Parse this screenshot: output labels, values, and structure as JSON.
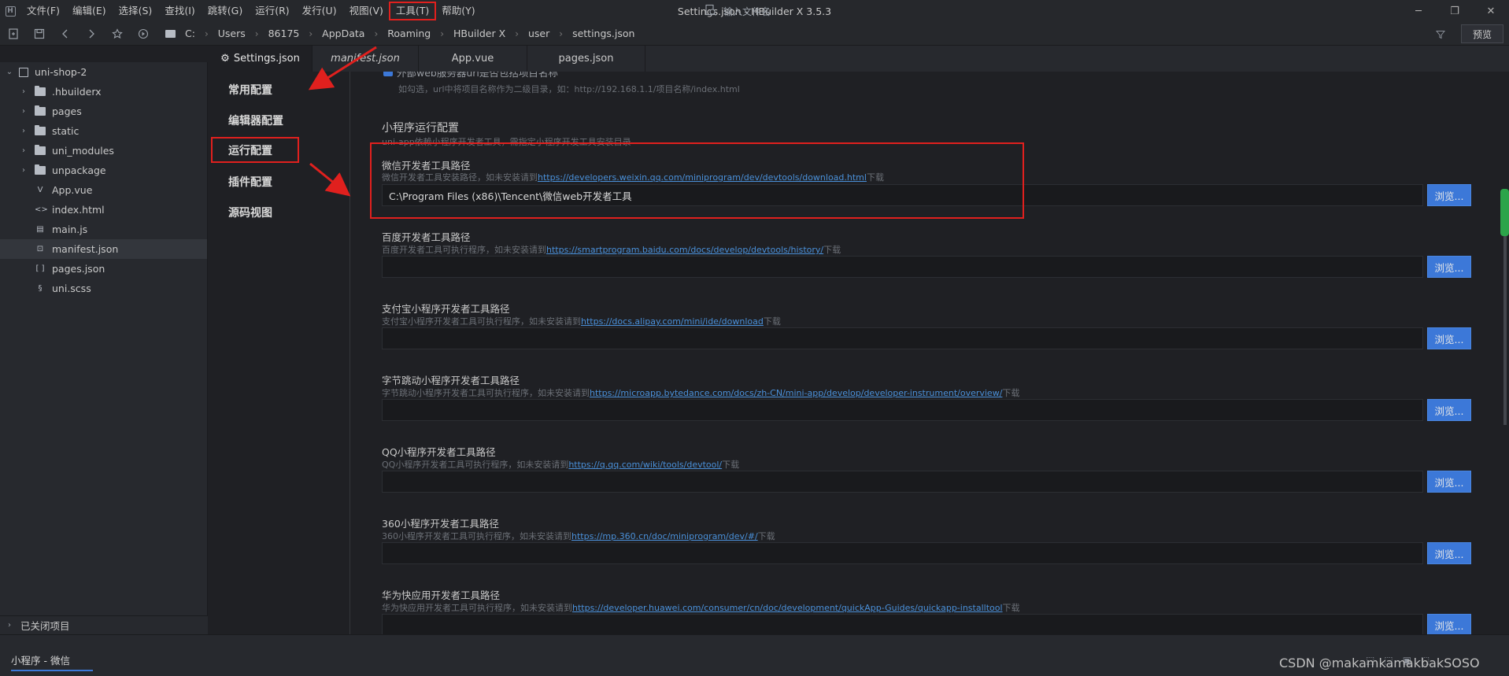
{
  "window": {
    "title": "Settings.json - HBuilder X 3.5.3",
    "logo_letter": "H",
    "controls": [
      "─",
      "❐",
      "✕"
    ]
  },
  "menu": [
    "文件(F)",
    "编辑(E)",
    "选择(S)",
    "查找(I)",
    "跳转(G)",
    "运行(R)",
    "发行(U)",
    "视图(V)",
    "工具(T)",
    "帮助(Y)"
  ],
  "breadcrumb": [
    "C:",
    "Users",
    "86175",
    "AppData",
    "Roaming",
    "HBuilder X",
    "user",
    "settings.json"
  ],
  "file_search": {
    "placeholder": "输入文件名"
  },
  "preview_label": "预览",
  "sidebar": {
    "project": "uni-shop-2",
    "items": [
      {
        "label": ".hbuilderx",
        "type": "folder"
      },
      {
        "label": "pages",
        "type": "folder"
      },
      {
        "label": "static",
        "type": "folder"
      },
      {
        "label": "uni_modules",
        "type": "folder"
      },
      {
        "label": "unpackage",
        "type": "folder"
      },
      {
        "label": "App.vue",
        "type": "vue"
      },
      {
        "label": "index.html",
        "type": "html"
      },
      {
        "label": "main.js",
        "type": "js"
      },
      {
        "label": "manifest.json",
        "type": "json-config"
      },
      {
        "label": "pages.json",
        "type": "json"
      },
      {
        "label": "uni.scss",
        "type": "scss"
      }
    ],
    "closed_projects": "已关闭项目"
  },
  "tabs": [
    {
      "label": "Settings.json"
    },
    {
      "label": "manifest.json"
    },
    {
      "label": "App.vue"
    },
    {
      "label": "pages.json"
    }
  ],
  "settings_nav": [
    {
      "label": "常用配置"
    },
    {
      "label": "编辑器配置"
    },
    {
      "label": "运行配置"
    },
    {
      "label": "插件配置"
    },
    {
      "label": "源码视图"
    }
  ],
  "main": {
    "top_cut_label": "外部web服务器url是否包括项目名称",
    "top_cut_desc": "如勾选，url中将项目名称作为二级目录，如：http://192.168.1.1/项目名称/index.html",
    "section_title": "小程序运行配置",
    "section_desc": "uni-app依赖小程序开发者工具，需指定小程序开发工具安装目录",
    "browse_label": "浏览...",
    "fields": [
      {
        "label": "微信开发者工具路径",
        "desc_prefix": "微信开发者工具安装路径，如未安装请到",
        "link": "https://developers.weixin.qq.com/miniprogram/dev/devtools/download.html",
        "desc_suffix": "下载",
        "value": "C:\\Program Files (x86)\\Tencent\\微信web开发者工具"
      },
      {
        "label": "百度开发者工具路径",
        "desc_prefix": "百度开发者工具可执行程序，如未安装请到",
        "link": "https://smartprogram.baidu.com/docs/develop/devtools/history/",
        "desc_suffix": "下载",
        "value": ""
      },
      {
        "label": "支付宝小程序开发者工具路径",
        "desc_prefix": "支付宝小程序开发者工具可执行程序，如未安装请到",
        "link": "https://docs.alipay.com/mini/ide/download",
        "desc_suffix": "下载",
        "value": ""
      },
      {
        "label": "字节跳动小程序开发者工具路径",
        "desc_prefix": "字节跳动小程序开发者工具可执行程序，如未安装请到",
        "link": "https://microapp.bytedance.com/docs/zh-CN/mini-app/develop/developer-instrument/overview/",
        "desc_suffix": "下载",
        "value": ""
      },
      {
        "label": "QQ小程序开发者工具路径",
        "desc_prefix": "QQ小程序开发者工具可执行程序，如未安装请到",
        "link": "https://q.qq.com/wiki/tools/devtool/",
        "desc_suffix": "下载",
        "value": ""
      },
      {
        "label": "360小程序开发者工具路径",
        "desc_prefix": "360小程序开发者工具可执行程序，如未安装请到",
        "link": "https://mp.360.cn/doc/miniprogram/dev/#/",
        "desc_suffix": "下载",
        "value": ""
      },
      {
        "label": "华为快应用开发者工具路径",
        "desc_prefix": "华为快应用开发者工具可执行程序，如未安装请到",
        "link": "https://developer.huawei.com/consumer/cn/doc/development/quickApp-Guides/quickapp-installtool",
        "desc_suffix": "下载",
        "value": ""
      }
    ]
  },
  "statusbar": {
    "tab": "小程序 - 微信",
    "watermark": "CSDN @makamkamakbakSOSO"
  },
  "colors": {
    "accent": "#3c78d8",
    "annotation": "#e0201e",
    "link": "#4a90d9"
  }
}
